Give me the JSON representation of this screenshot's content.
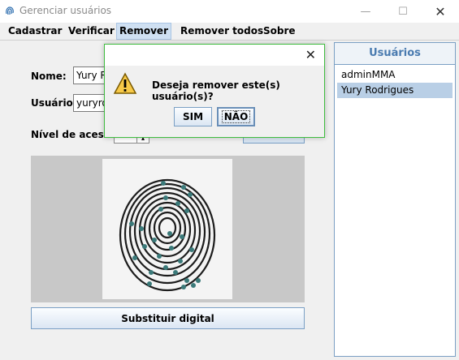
{
  "window": {
    "title": "Gerenciar usuários",
    "minimize_icon": "minimize-icon",
    "maximize_icon": "maximize-icon",
    "close_icon": "close-icon"
  },
  "menu": {
    "items": [
      "Cadastrar",
      "Verificar",
      "Remover",
      "Remover todos",
      "Sobre"
    ],
    "active": "Remover"
  },
  "form": {
    "name_label": "Nome:",
    "name_value": "Yury R",
    "user_label": "Usuário:",
    "user_value": "yuryroc",
    "access_label": "Nível de acesso:"
  },
  "replace_button": "Substituir digital",
  "users_panel": {
    "title": "Usuários",
    "items": [
      "adminMMA",
      "Yury Rodrigues"
    ],
    "selected": "Yury Rodrigues"
  },
  "dialog": {
    "message": "Deseja remover este(s) usuário(s)?",
    "yes": "SIM",
    "no": "NÃO",
    "icon": "warning-icon"
  },
  "colors": {
    "accent": "#4a7bb0",
    "dialog_border": "#3fbd3f",
    "selection": "#b9cfe6"
  }
}
